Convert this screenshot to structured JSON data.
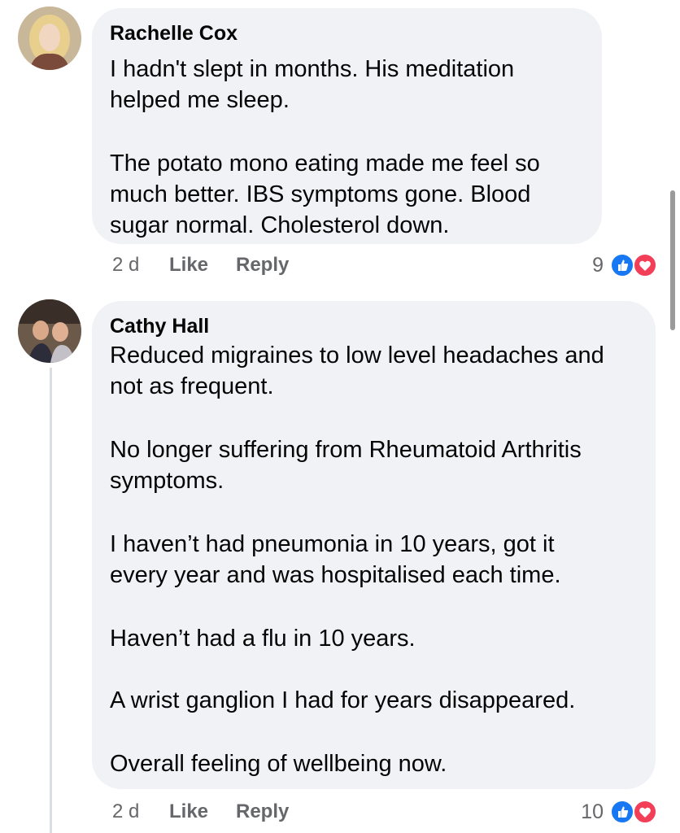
{
  "comments": [
    {
      "author": "Rachelle Cox",
      "paragraphs": [
        "I hadn't slept in months. His meditation helped me sleep.",
        "The potato mono eating made me feel so much better. IBS symptoms gone. Blood sugar normal. Cholesterol down."
      ],
      "time": "2 d",
      "like_label": "Like",
      "reply_label": "Reply",
      "reaction_count": "9",
      "reactions": [
        "like-icon",
        "love-icon"
      ]
    },
    {
      "author": "Cathy Hall",
      "paragraphs": [
        "Reduced migraines to low level headaches and not as frequent.",
        "No longer suffering from Rheumatoid Arthritis symptoms.",
        "I haven’t had pneumonia in 10 years, got it every year and was hospitalised each time.",
        "Haven’t had a flu in 10 years.",
        "A wrist ganglion I had for years disappeared.",
        "Overall feeling of wellbeing now."
      ],
      "time": "2 d",
      "like_label": "Like",
      "reply_label": "Reply",
      "reaction_count": "10",
      "reactions": [
        "like-icon",
        "love-icon"
      ]
    }
  ],
  "colors": {
    "bubble": "#f0f2f5",
    "meta_text": "#65676b",
    "like_blue": "#1877f2",
    "love_red": "#f33e58"
  }
}
